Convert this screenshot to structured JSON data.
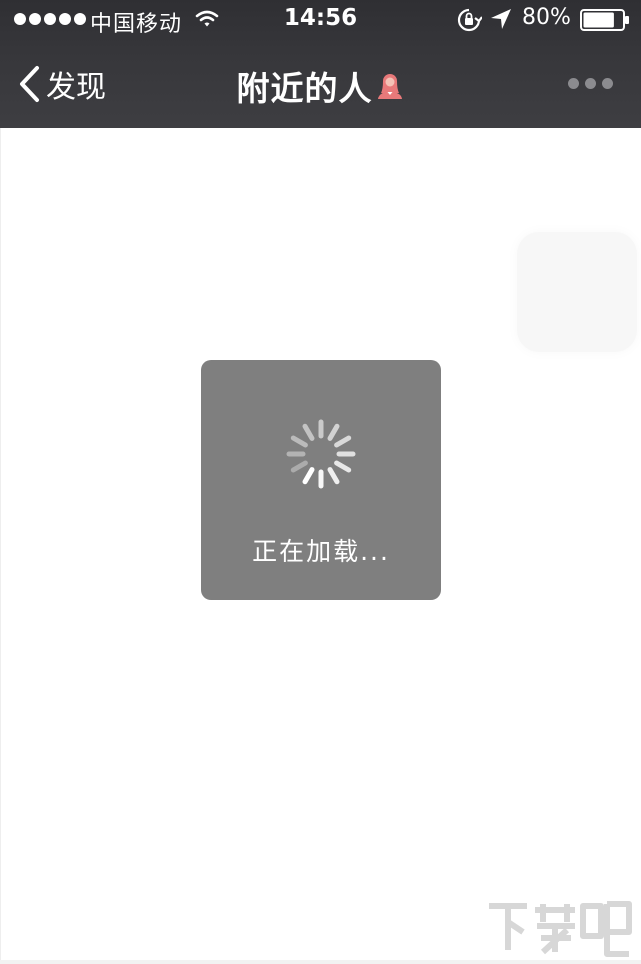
{
  "status_bar": {
    "carrier": "中国移动",
    "time": "14:56",
    "battery_percent": "80%",
    "battery_level": 0.8,
    "signal_bars": 5,
    "icons": [
      "signal-dots-icon",
      "wifi-icon",
      "rotation-lock-icon",
      "location-arrow-icon",
      "battery-icon"
    ]
  },
  "nav_bar": {
    "back_label": "发现",
    "title": "附近的人",
    "title_icon": "female-person-icon",
    "more_icon": "more-dots-icon",
    "colors": {
      "background": "#38383c",
      "text": "#ffffff",
      "title_icon": "#e8797a"
    }
  },
  "loading_toast": {
    "message": "正在加载...",
    "icon": "spinner-icon",
    "background": "#7f7f7f"
  },
  "watermark": {
    "icon": "xiazaiba-watermark-logo"
  }
}
